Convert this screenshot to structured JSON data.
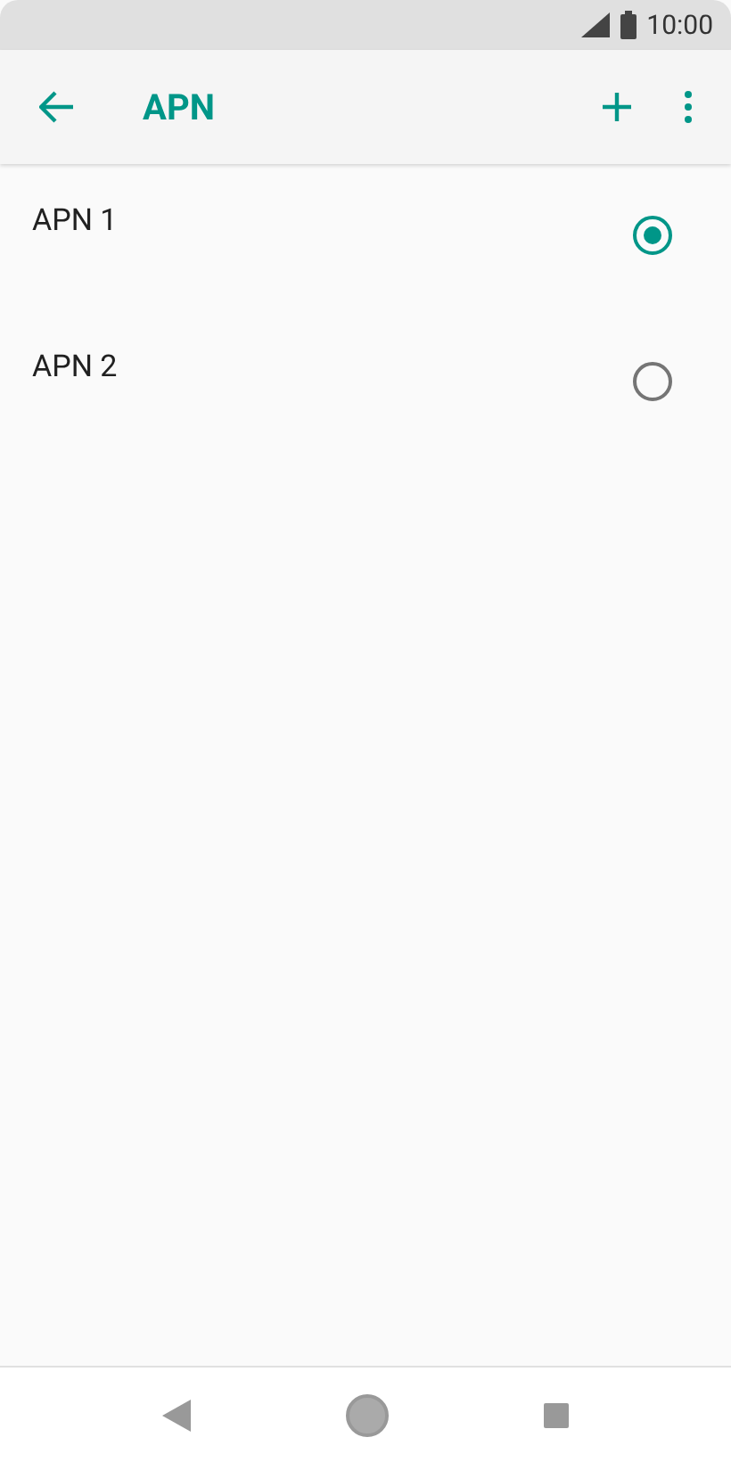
{
  "status_bar": {
    "time": "10:00"
  },
  "toolbar": {
    "title": "APN"
  },
  "apns": [
    {
      "name": "APN 1",
      "selected": true
    },
    {
      "name": "APN 2",
      "selected": false
    }
  ]
}
